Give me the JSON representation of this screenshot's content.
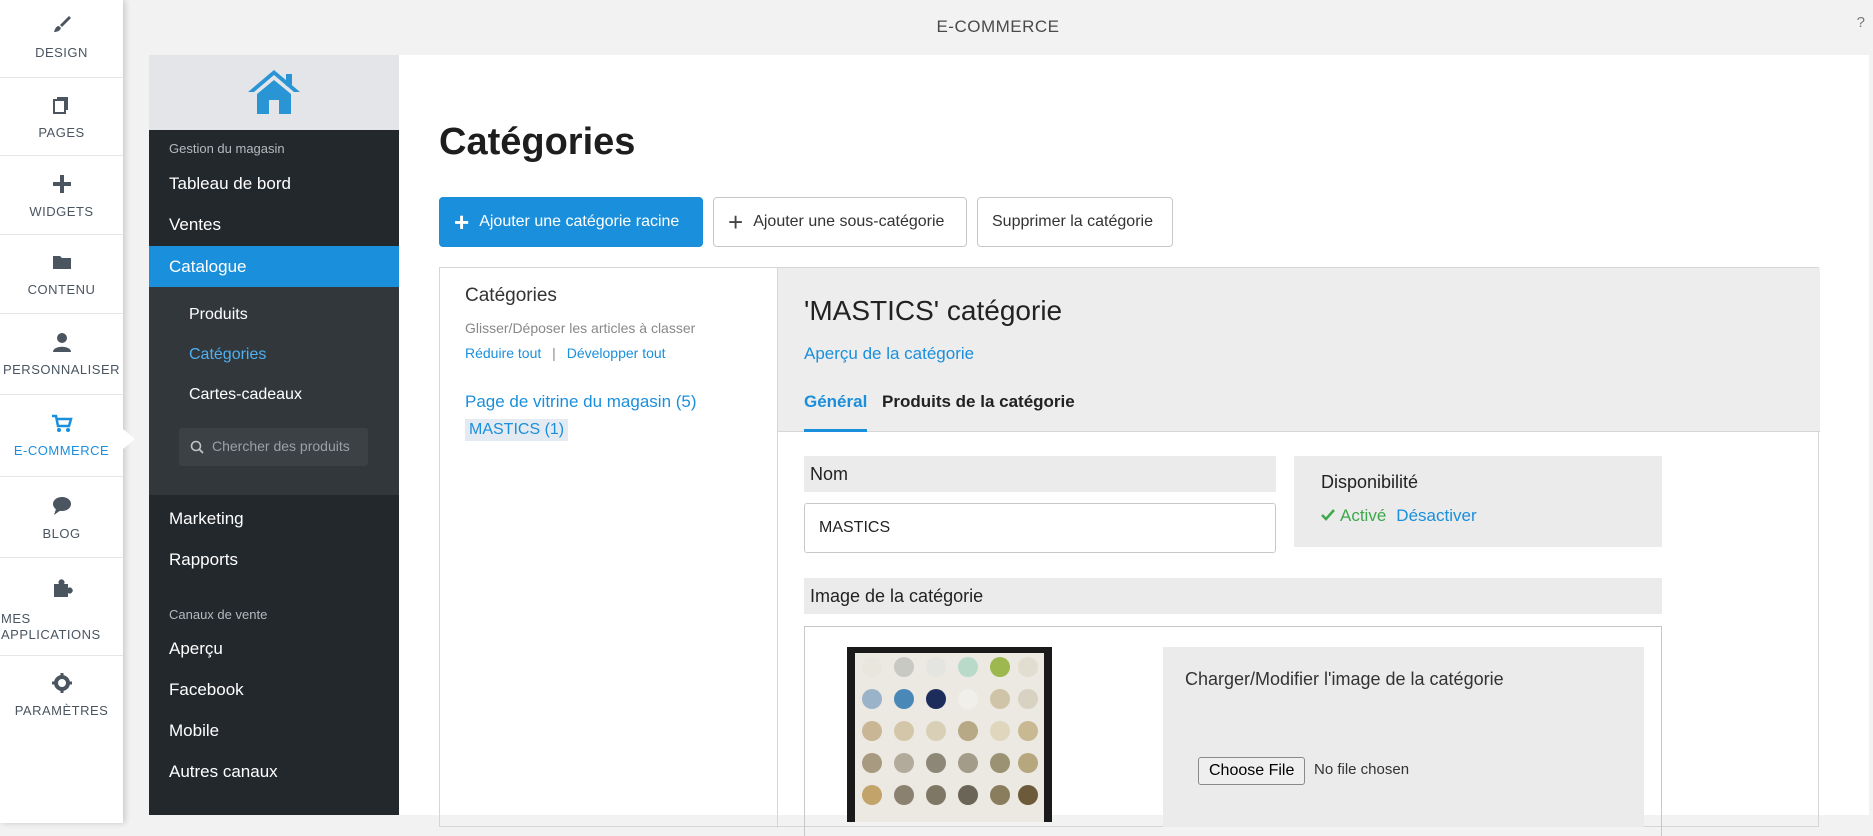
{
  "app_title": "E-COMMERCE",
  "help_label": "?",
  "rail": [
    {
      "label": "DESIGN",
      "icon": "brush-icon"
    },
    {
      "label": "PAGES",
      "icon": "pages-icon"
    },
    {
      "label": "WIDGETS",
      "icon": "plus-icon"
    },
    {
      "label": "CONTENU",
      "icon": "folder-icon"
    },
    {
      "label": "PERSONNALISER",
      "icon": "user-icon"
    },
    {
      "label": "E-COMMERCE",
      "icon": "cart-icon",
      "active": true
    },
    {
      "label": "BLOG",
      "icon": "chat-icon"
    },
    {
      "label_line1": "MES",
      "label_line2": "APPLICATIONS",
      "icon": "puzzle-icon"
    },
    {
      "label": "PARAMÈTRES",
      "icon": "gear-icon"
    }
  ],
  "sidebar": {
    "section1": "Gestion du magasin",
    "items_top": [
      "Tableau de bord",
      "Ventes",
      "Catalogue"
    ],
    "catalogue_sub": [
      "Produits",
      "Catégories",
      "Cartes-cadeaux"
    ],
    "search_placeholder": "Chercher des produits",
    "items_mid": [
      "Marketing",
      "Rapports"
    ],
    "section2": "Canaux de vente",
    "items_bottom": [
      "Aperçu",
      "Facebook",
      "Mobile",
      "Autres canaux"
    ]
  },
  "page": {
    "title": "Catégories",
    "btn_add_root": "Ajouter une catégorie racine",
    "btn_add_sub": "Ajouter une sous-catégorie",
    "btn_delete": "Supprimer la catégorie"
  },
  "tree": {
    "heading": "Catégories",
    "hint": "Glisser/Déposer les articles à classer",
    "collapse_all": "Réduire tout",
    "separator": "|",
    "expand_all": "Développer tout",
    "root_node": "Page de vitrine du magasin (5)",
    "child_node": "MASTICS (1)"
  },
  "detail": {
    "title": "'MASTICS' catégorie",
    "preview_link": "Aperçu de la catégorie",
    "tab_general": "Général",
    "tab_products": "Produits de la catégorie",
    "name_label": "Nom",
    "name_value": "MASTICS",
    "availability_label": "Disponibilité",
    "status_icon": "check-icon",
    "status_text": "Activé",
    "deactivate_link": "Désactiver",
    "image_label": "Image de la catégorie",
    "upload_heading": "Charger/Modifier l'image de la catégorie",
    "choose_file": "Choose File",
    "no_file": "No file chosen"
  },
  "colors": {
    "accent": "#1a8fdc",
    "sidebar_bg": "#23282d",
    "success": "#3ea84a"
  }
}
